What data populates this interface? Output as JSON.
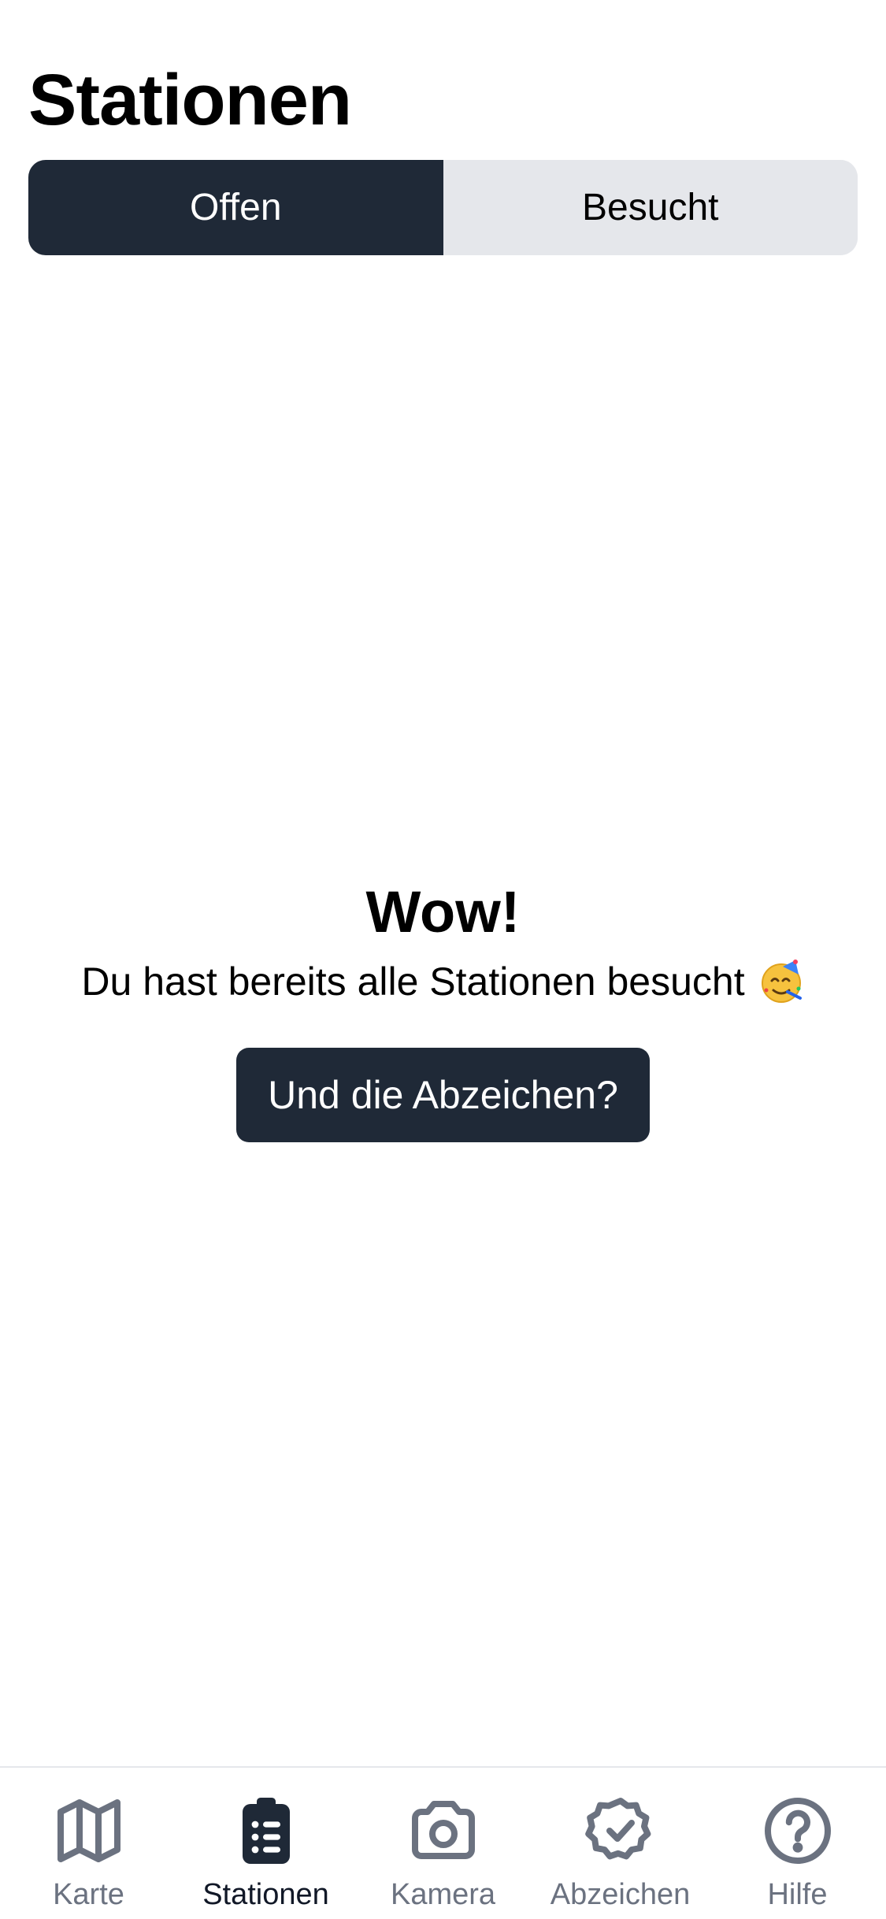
{
  "header": {
    "title": "Stationen"
  },
  "segments": {
    "open_label": "Offen",
    "visited_label": "Besucht",
    "active": "open"
  },
  "empty_state": {
    "title": "Wow!",
    "message": "Du hast bereits alle Stationen besucht",
    "emoji_icon": "party-face-icon",
    "button_label": "Und die Abzeichen?"
  },
  "tabbar": {
    "active": "stationen",
    "items": [
      {
        "id": "karte",
        "label": "Karte",
        "icon": "map-icon"
      },
      {
        "id": "stationen",
        "label": "Stationen",
        "icon": "clipboard-list-icon"
      },
      {
        "id": "kamera",
        "label": "Kamera",
        "icon": "camera-icon"
      },
      {
        "id": "abzeichen",
        "label": "Abzeichen",
        "icon": "badge-check-icon"
      },
      {
        "id": "hilfe",
        "label": "Hilfe",
        "icon": "question-circle-icon"
      }
    ]
  },
  "colors": {
    "primary": "#1f2937",
    "inactive_segment": "#e5e7eb",
    "tab_inactive": "#6b7280",
    "tab_active": "#111827"
  }
}
